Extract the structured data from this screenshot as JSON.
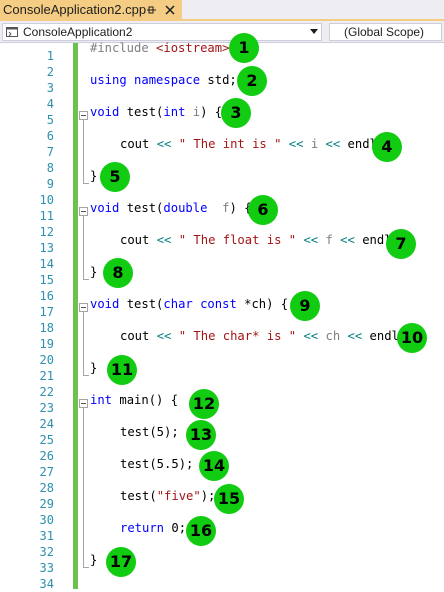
{
  "tab": {
    "title": "ConsoleApplication2.cpp",
    "pin_icon": "pin-icon",
    "close_icon": "close-icon"
  },
  "navbar": {
    "project": "ConsoleApplication2",
    "scope": "(Global Scope)",
    "project_icon": "project-icon",
    "chevron_icon": "chevron-down-icon"
  },
  "line_numbers": [
    "1",
    "2",
    "3",
    "4",
    "5",
    "6",
    "7",
    "8",
    "9",
    "10",
    "11",
    "12",
    "13",
    "14",
    "15",
    "16",
    "17",
    "18",
    "19",
    "20",
    "21",
    "22",
    "23",
    "24",
    "25",
    "26",
    "27",
    "28",
    "29",
    "30",
    "31",
    "32",
    "33",
    "34"
  ],
  "code": {
    "l1": {
      "directive": "#include",
      "file": "<iostream>"
    },
    "l3": {
      "kw1": "using",
      "kw2": "namespace",
      "rest": "std;"
    },
    "l5": {
      "kw": "void",
      "name": "test(",
      "type": "int",
      "param": "i",
      "rest": ") {"
    },
    "l7": {
      "a": "cout ",
      "op1": "<<",
      "str": "\" The int is \"",
      "b": " ",
      "op2": "<<",
      "var": " i ",
      "op3": "<<",
      "c": " endl;"
    },
    "l9": "}",
    "l11": {
      "kw": "void",
      "name": "test(",
      "type": "double",
      "param": "f",
      "rest": ") {"
    },
    "l13": {
      "a": "cout ",
      "op1": "<<",
      "str": "\" The float is \"",
      "b": " ",
      "op2": "<<",
      "var": " f ",
      "op3": "<<",
      "c": " endl;"
    },
    "l15": "}",
    "l17": {
      "kw": "void",
      "name": "test(",
      "type": "char",
      "kw2": "const",
      "rest": "*ch) {"
    },
    "l19": {
      "a": "cout ",
      "op1": "<<",
      "str": "\" The char* is \"",
      "b": " ",
      "op2": "<<",
      "var": " ch ",
      "op3": "<<",
      "c": " endl;"
    },
    "l21": "}",
    "l23": {
      "kw": "int",
      "rest": "main() {"
    },
    "l25": "test(5);",
    "l27": "test(5.5);",
    "l29": {
      "a": "test(",
      "str": "\"five\"",
      "b": ");"
    },
    "l31": {
      "kw": "return",
      "rest": "0;"
    },
    "l33": "}"
  },
  "badges": [
    "1",
    "2",
    "3",
    "4",
    "5",
    "6",
    "7",
    "8",
    "9",
    "10",
    "11",
    "12",
    "13",
    "14",
    "15",
    "16",
    "17"
  ],
  "colors": {
    "tab_accent": "#f5cc84",
    "change_bar": "#6cc24a",
    "badge": "#11cc11",
    "keyword": "#0000ff",
    "string": "#a31515",
    "line_number": "#2b91af"
  }
}
